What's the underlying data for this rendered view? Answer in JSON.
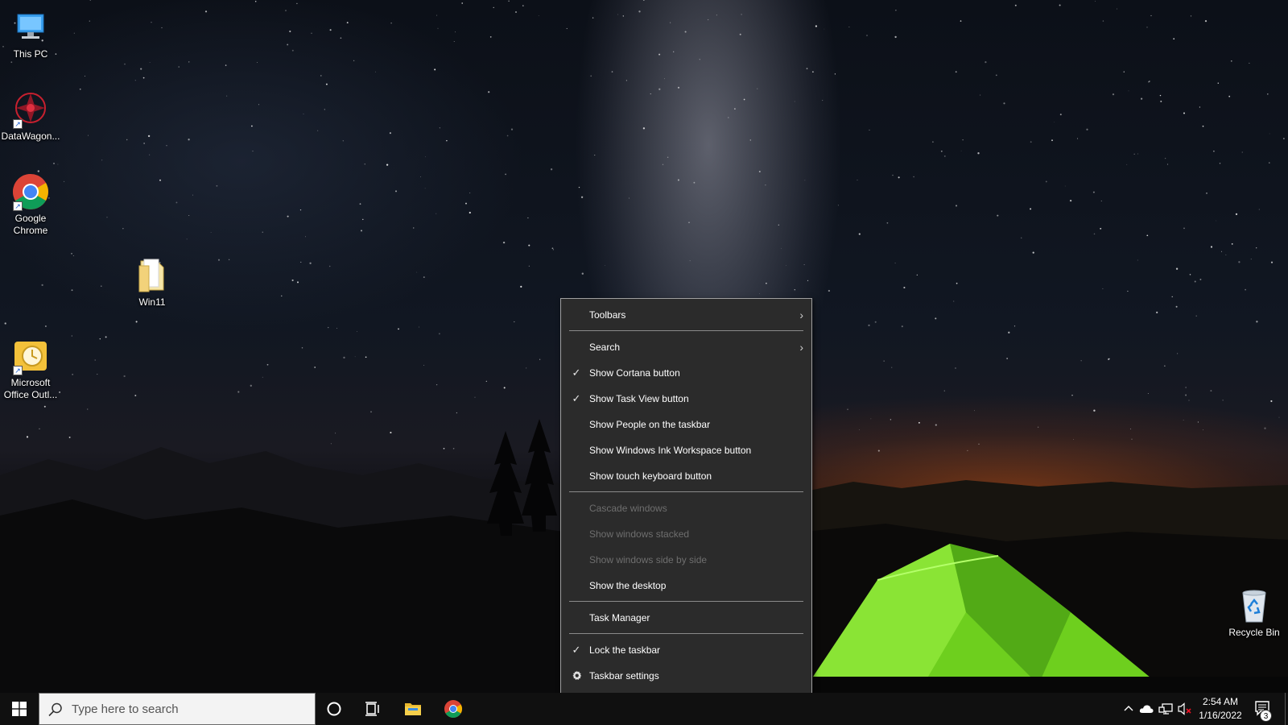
{
  "desktop": {
    "icons": [
      {
        "label": "This PC"
      },
      {
        "label": "DataWagon..."
      },
      {
        "label": "Google\nChrome"
      },
      {
        "label": "Win11"
      },
      {
        "label": "Microsoft\nOffice Outl..."
      },
      {
        "label": "Recycle Bin"
      }
    ]
  },
  "context_menu": {
    "items": [
      {
        "label": "Toolbars",
        "checked": false,
        "has_submenu": true,
        "enabled": true
      },
      {
        "label": "Search",
        "checked": false,
        "has_submenu": true,
        "enabled": true
      },
      {
        "label": "Show Cortana button",
        "checked": true,
        "enabled": true
      },
      {
        "label": "Show Task View button",
        "checked": true,
        "enabled": true
      },
      {
        "label": "Show People on the taskbar",
        "checked": false,
        "enabled": true
      },
      {
        "label": "Show Windows Ink Workspace button",
        "checked": false,
        "enabled": true
      },
      {
        "label": "Show touch keyboard button",
        "checked": false,
        "enabled": true
      },
      {
        "label": "Cascade windows",
        "checked": false,
        "enabled": false
      },
      {
        "label": "Show windows stacked",
        "checked": false,
        "enabled": false
      },
      {
        "label": "Show windows side by side",
        "checked": false,
        "enabled": false
      },
      {
        "label": "Show the desktop",
        "checked": false,
        "enabled": true
      },
      {
        "label": "Task Manager",
        "checked": false,
        "enabled": true
      },
      {
        "label": "Lock the taskbar",
        "checked": true,
        "enabled": true
      },
      {
        "label": "Taskbar settings",
        "icon": "gear-icon",
        "enabled": true
      }
    ],
    "check_glyph": "✓",
    "submenu_glyph": "›"
  },
  "taskbar": {
    "search_placeholder": "Type here to search",
    "pinned": [
      "cortana-icon",
      "task-view-icon",
      "file-explorer-icon",
      "chrome-icon"
    ],
    "tray": {
      "time": "2:54 AM",
      "date": "1/16/2022",
      "notification_count": "3",
      "icons": [
        "chevron-up-icon",
        "onedrive-icon",
        "network-icon",
        "volume-muted-icon",
        "action-center-icon"
      ]
    }
  },
  "colors": {
    "menu_bg": "#2b2b2b",
    "menu_text": "#ffffff",
    "menu_disabled": "#6e6e6e",
    "taskbar_bg": "#101010",
    "accent_blue": "#0078d7"
  }
}
